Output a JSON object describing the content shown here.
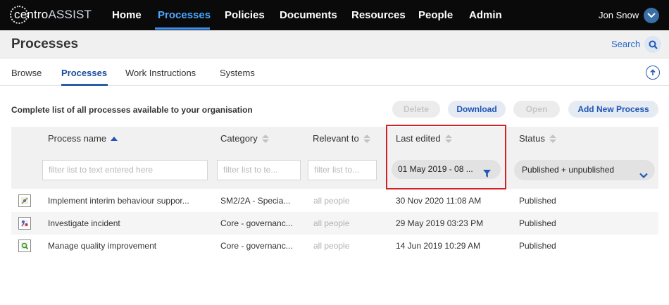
{
  "brand": {
    "logo_prefix": "centro",
    "logo_suffix": "ASSIST"
  },
  "nav": {
    "items": [
      {
        "label": "Home"
      },
      {
        "label": "Processes"
      },
      {
        "label": "Policies"
      },
      {
        "label": "Documents"
      },
      {
        "label": "Resources"
      },
      {
        "label": "People"
      },
      {
        "label": "Admin"
      }
    ],
    "active": "Processes",
    "user_name": "Jon Snow"
  },
  "page": {
    "title": "Processes",
    "search_label": "Search"
  },
  "tabs": [
    {
      "label": "Browse"
    },
    {
      "label": "Processes"
    },
    {
      "label": "Work Instructions"
    },
    {
      "label": "Systems"
    }
  ],
  "active_tab": "Processes",
  "toolbar": {
    "subtitle": "Complete list of all processes available to your organisation",
    "delete_label": "Delete",
    "download_label": "Download",
    "open_label": "Open",
    "add_label": "Add New Process"
  },
  "table": {
    "columns": [
      {
        "label": "Process name"
      },
      {
        "label": "Category"
      },
      {
        "label": "Relevant to"
      },
      {
        "label": "Last edited"
      },
      {
        "label": "Status"
      }
    ],
    "sorted_column": "Process name",
    "filters": {
      "process_name_placeholder": "filter list to text entered here",
      "category_placeholder": "filter list to te...",
      "relevant_placeholder": "filter list to...",
      "last_edited_value": "01 May 2019 - 08 ...",
      "status_value": "Published + unpublished"
    },
    "rows": [
      {
        "name": "Implement interim behaviour suppor...",
        "category": "SM2/2A - Specia...",
        "relevant": "all people",
        "edited": "30 Nov 2020 11:08 AM",
        "status": "Published"
      },
      {
        "name": "Investigate incident",
        "category": "Core - governanc...",
        "relevant": "all people",
        "edited": "29 May 2019 03:23 PM",
        "status": "Published"
      },
      {
        "name": "Manage quality improvement",
        "category": "Core - governanc...",
        "relevant": "all people",
        "edited": "14 Jun 2019 10:29 AM",
        "status": "Published"
      }
    ]
  },
  "colors": {
    "nav_bg": "#0a0a0a",
    "accent": "#1f56b3",
    "highlight": "#d32027"
  },
  "icons": [
    "user-menu-chevron-icon",
    "search-icon",
    "upload-icon",
    "sort-icon",
    "funnel-icon",
    "chevron-down-icon",
    "process-icon"
  ]
}
